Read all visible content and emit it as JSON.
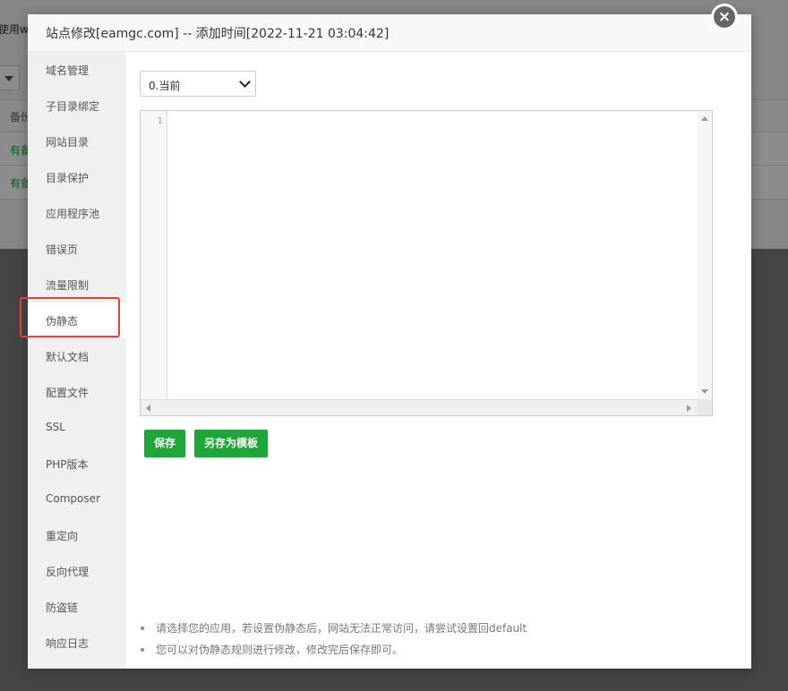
{
  "background": {
    "use_text": "使用w",
    "row_header": "备份",
    "row1": "有备",
    "row2": "有备"
  },
  "dialog": {
    "title": "站点修改[eamgc.com] -- 添加时间[2022-11-21 03:04:42]",
    "close_glyph": "×"
  },
  "sidebar": {
    "items": [
      {
        "label": "域名管理"
      },
      {
        "label": "子目录绑定"
      },
      {
        "label": "网站目录"
      },
      {
        "label": "目录保护"
      },
      {
        "label": "应用程序池"
      },
      {
        "label": "错误页"
      },
      {
        "label": "流量限制"
      },
      {
        "label": "伪静态"
      },
      {
        "label": "默认文档"
      },
      {
        "label": "配置文件"
      },
      {
        "label": "SSL"
      },
      {
        "label": "PHP版本"
      },
      {
        "label": "Composer"
      },
      {
        "label": "重定向"
      },
      {
        "label": "反向代理"
      },
      {
        "label": "防盗链"
      },
      {
        "label": "响应日志"
      }
    ],
    "active_index": 7
  },
  "content": {
    "version_select": "0.当前",
    "editor": {
      "line_numbers": [
        "1"
      ],
      "text": ""
    },
    "buttons": {
      "save": "保存",
      "save_as_template": "另存为模板"
    },
    "notes": [
      "请选择您的应用，若设置伪静态后，网站无法正常访问，请尝试设置回default",
      "您可以对伪静态规则进行修改，修改完后保存即可。"
    ]
  },
  "colors": {
    "accent_green": "#20a53a",
    "highlight_red": "#e5403a"
  },
  "icons": {
    "close": "close-icon",
    "select": "chevron-down-icon"
  }
}
